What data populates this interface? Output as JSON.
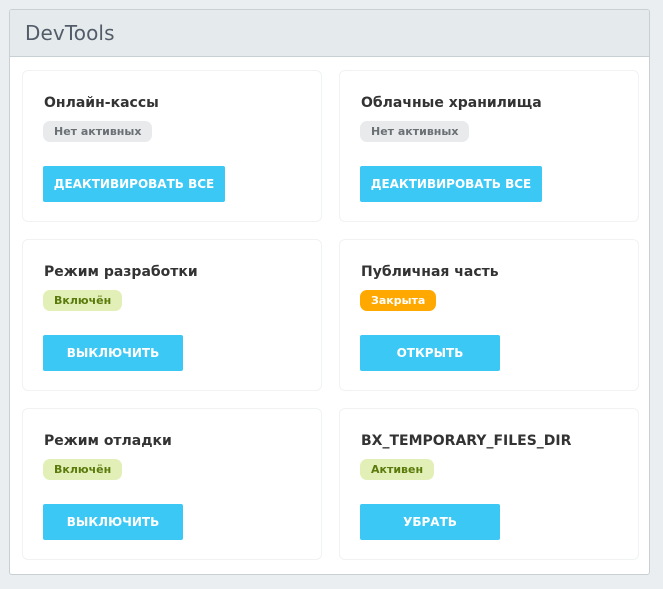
{
  "panel": {
    "title": "DevTools"
  },
  "cards": [
    {
      "title": "Онлайн-кассы",
      "status": "Нет активных",
      "status_color": "#e8eaeb",
      "action": "Деактивировать все"
    },
    {
      "title": "Облачные хранилища",
      "status": "Нет активных",
      "status_color": "#e8eaeb",
      "action": "Деактивировать все"
    },
    {
      "title": "Режим разработки",
      "status": "Включён",
      "status_color": "#e2f0b7",
      "action": "Выключить"
    },
    {
      "title": "Публичная часть",
      "status": "Закрыта",
      "status_color": "#ffa900",
      "action": "Открыть"
    },
    {
      "title": "Режим отладки",
      "status": "Включён",
      "status_color": "#e2f0b7",
      "action": "Выключить"
    },
    {
      "title": "BX_TEMPORARY_FILES_DIR",
      "status": "Активен",
      "status_color": "#e2f0b7",
      "action": "Убрать"
    }
  ],
  "colors": {
    "button": "#3bc8f5",
    "header_bg": "#e5eaec"
  }
}
